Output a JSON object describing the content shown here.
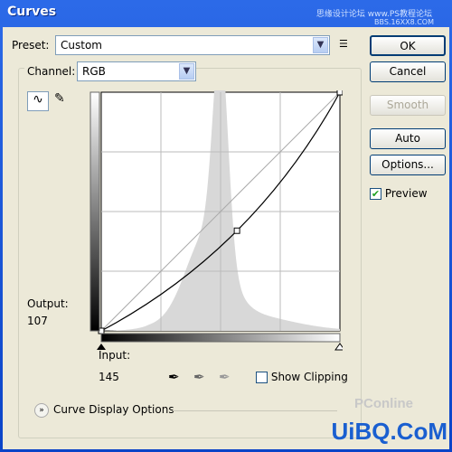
{
  "window": {
    "title": "Curves",
    "watermark_top": "思缘设计论坛 www.PS教程论坛",
    "watermark_sub": "BBS.16XX8.COM",
    "watermark_bottom": "UiBQ.CoM",
    "watermark_pconline": "PConline"
  },
  "preset": {
    "label": "Preset:",
    "value": "Custom"
  },
  "channel": {
    "label": "Channel:",
    "value": "RGB"
  },
  "buttons": {
    "ok": "OK",
    "cancel": "Cancel",
    "smooth": "Smooth",
    "auto": "Auto",
    "options": "Options..."
  },
  "preview": {
    "label": "Preview",
    "checked": true
  },
  "output": {
    "label": "Output:",
    "value": "107"
  },
  "input": {
    "label": "Input:",
    "value": "145"
  },
  "show_clipping": {
    "label": "Show Clipping",
    "checked": false
  },
  "curve_display_options": "Curve Display Options",
  "curve_points": [
    [
      0,
      0
    ],
    [
      145,
      107
    ],
    [
      255,
      255
    ]
  ],
  "colors": {
    "title_bar": "#0b44c8",
    "dialog_bg": "#ece9d8",
    "histogram": "#d8d8d8"
  }
}
